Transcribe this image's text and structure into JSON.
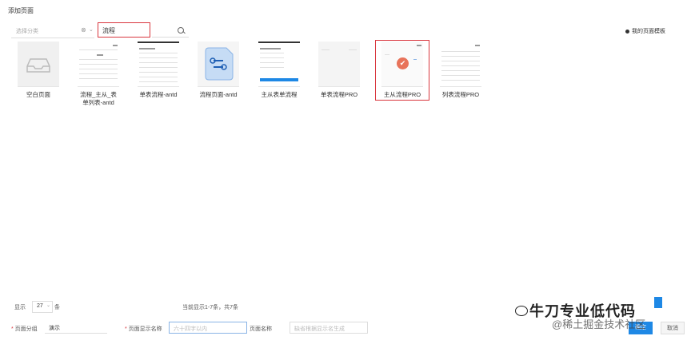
{
  "dialog": {
    "title": "添加页面"
  },
  "filters": {
    "category_placeholder": "选择分类",
    "search_value": "流程",
    "my_templates_label": "我的页面模板"
  },
  "templates": [
    {
      "name": "空白页面"
    },
    {
      "name": "流程_主从_表单列表-antd"
    },
    {
      "name": "单表流程-antd"
    },
    {
      "name": "流程页面-antd"
    },
    {
      "name": "主从表单流程"
    },
    {
      "name": "单表流程PRO"
    },
    {
      "name": "主从流程PRO",
      "selected": true
    },
    {
      "name": "列表流程PRO"
    }
  ],
  "pagination": {
    "show_label": "显示",
    "page_size": "27",
    "unit_label": "条",
    "summary": "当前显示1-7条，共7条"
  },
  "form": {
    "group_label": "页面分组",
    "group_value": "演示",
    "display_name_label": "页面显示名称",
    "display_name_placeholder": "六十四字以内",
    "page_name_label": "页面名称",
    "page_name_placeholder": "缺省根据显示名生成"
  },
  "buttons": {
    "confirm": "确定",
    "cancel": "取消"
  },
  "watermark": {
    "line1": "牛刀专业低代码",
    "line2": "@稀土掘金技术社区"
  }
}
